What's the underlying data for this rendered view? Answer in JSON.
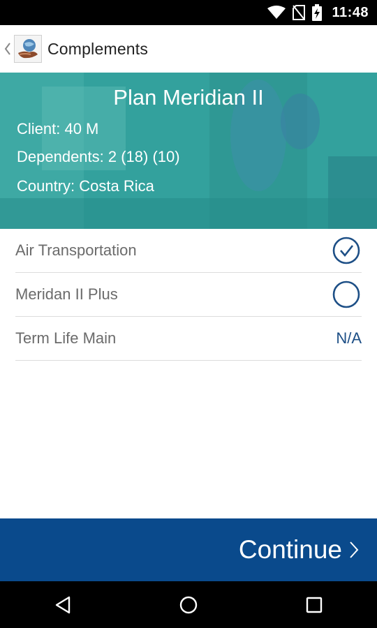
{
  "status_bar": {
    "time": "11:48",
    "icons": [
      "wifi-icon",
      "no-sim-icon",
      "battery-charging-icon"
    ]
  },
  "app_bar": {
    "back_icon": "chevron-left-icon",
    "title": "Complements"
  },
  "plan": {
    "title": "Plan Meridian II",
    "client": "Client: 40 M",
    "dependents": "Dependents: 2 (18) (10)",
    "country": "Country: Costa Rica"
  },
  "complements": [
    {
      "label": "Air Transportation",
      "state": "checked"
    },
    {
      "label": "Meridan II Plus",
      "state": "unchecked"
    },
    {
      "label": "Term Life Main",
      "state": "na",
      "value": "N/A"
    }
  ],
  "continue_button": {
    "label": "Continue"
  },
  "nav_bar": {
    "icons": [
      "back-triangle-icon",
      "home-circle-icon",
      "recents-square-icon"
    ]
  },
  "colors": {
    "accent": "#1d4f86",
    "continue_bg": "#0a4a8c",
    "hero_teal": "#2c9a96"
  }
}
